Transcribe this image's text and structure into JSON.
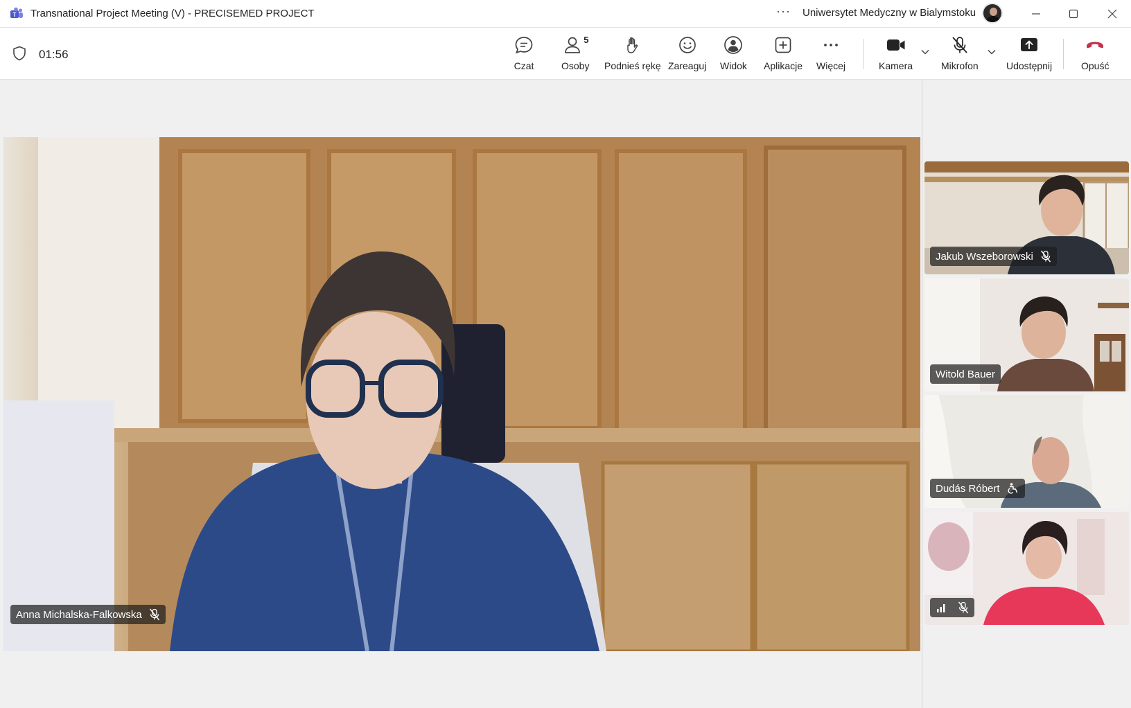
{
  "window": {
    "title": "Transnational Project Meeting (V) - PRECISEMED PROJECT",
    "org": "Uniwersytet Medyczny w Bialymstoku",
    "more_icon": "ellipsis-icon",
    "controls": [
      "minimize-icon",
      "maximize-icon",
      "close-icon"
    ]
  },
  "meeting": {
    "timer": "01:56"
  },
  "toolbar": {
    "chat": "Czat",
    "people": "Osoby",
    "people_count": "5",
    "raise_hand": "Podnieś rękę",
    "react": "Zareaguj",
    "view": "Widok",
    "apps": "Aplikacje",
    "more": "Więcej",
    "camera": "Kamera",
    "mic": "Mikrofon",
    "share": "Udostępnij",
    "leave": "Opuść"
  },
  "colors": {
    "leave_red": "#c4314b",
    "toolbar_bg": "#ffffff",
    "stage_bg": "#f0f0f0"
  },
  "participants": {
    "main": {
      "name": "Anna Michalska-Falkowska",
      "muted": true
    },
    "tiles": [
      {
        "name": "Jakub Wszeborowski",
        "muted": true
      },
      {
        "name": "Witold Bauer",
        "muted": false
      },
      {
        "name": "Dudás Róbert",
        "muted": false,
        "status_icon": "accessibility-icon"
      },
      {
        "name": "",
        "muted": true,
        "status_icon": "signal-bars-icon"
      }
    ]
  }
}
